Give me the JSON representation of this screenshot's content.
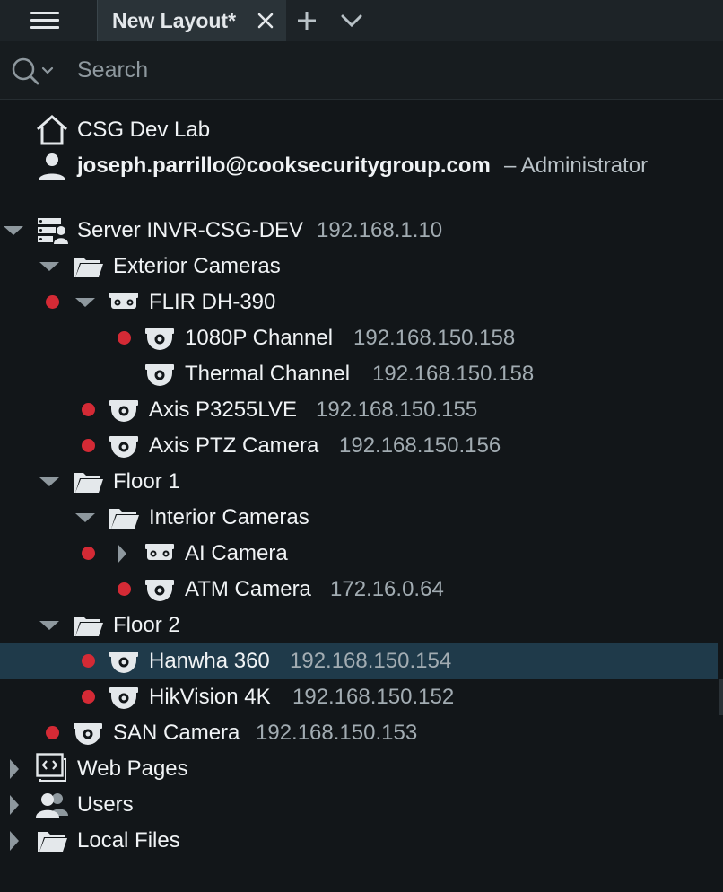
{
  "topbar": {
    "tab_label": "New Layout*"
  },
  "search": {
    "placeholder": "Search"
  },
  "header": {
    "site_name": "CSG Dev Lab",
    "user_email": "joseph.parrillo@cooksecuritygroup.com",
    "user_role": "– Administrator"
  },
  "tree": {
    "server": {
      "name": "Server INVR-CSG-DEV",
      "ip": "192.168.1.10"
    },
    "exterior": {
      "name": "Exterior Cameras"
    },
    "flir": {
      "name": "FLIR DH-390"
    },
    "ch1080": {
      "name": "1080P Channel",
      "ip": "192.168.150.158"
    },
    "thermal": {
      "name": "Thermal Channel",
      "ip": "192.168.150.158"
    },
    "axis1": {
      "name": "Axis P3255LVE",
      "ip": "192.168.150.155"
    },
    "axis2": {
      "name": "Axis PTZ Camera",
      "ip": "192.168.150.156"
    },
    "floor1": {
      "name": "Floor 1"
    },
    "interior": {
      "name": "Interior Cameras"
    },
    "ai": {
      "name": "AI Camera"
    },
    "atm": {
      "name": "ATM Camera",
      "ip": "172.16.0.64"
    },
    "floor2": {
      "name": "Floor 2"
    },
    "hanwha": {
      "name": "Hanwha 360",
      "ip": "192.168.150.154"
    },
    "hik": {
      "name": "HikVision 4K",
      "ip": "192.168.150.152"
    },
    "san": {
      "name": "SAN Camera",
      "ip": "192.168.150.153"
    },
    "webpages": {
      "name": "Web Pages"
    },
    "users": {
      "name": "Users"
    },
    "localfiles": {
      "name": "Local Files"
    }
  },
  "colors": {
    "background": "#121619",
    "selected_row": "#1f3a4a",
    "status_dot": "#d42a35",
    "ip_text": "#a2acb2"
  }
}
